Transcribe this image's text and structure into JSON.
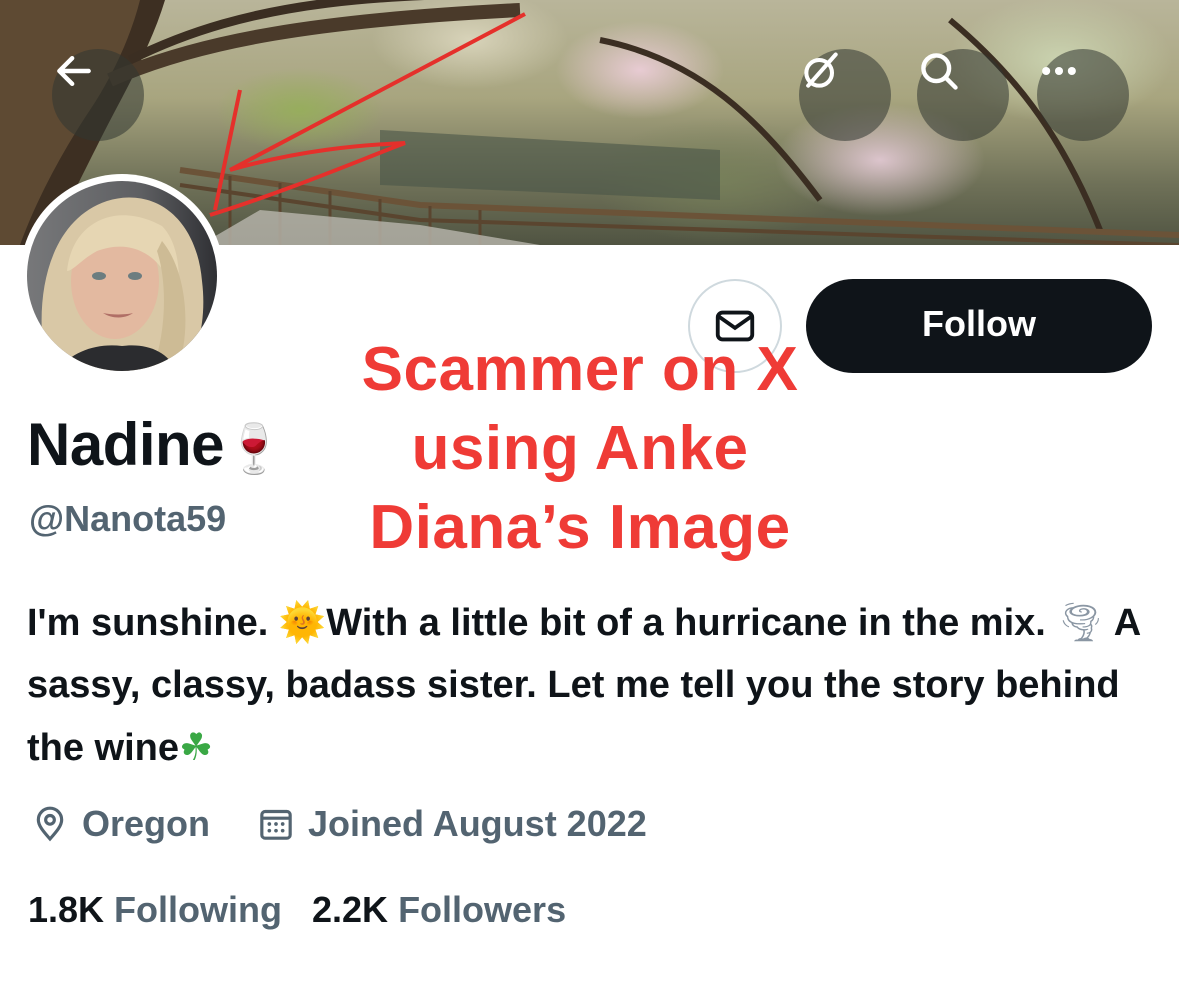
{
  "header": {
    "back_icon": "arrow-left-icon",
    "actions": [
      "grok-icon",
      "search-icon",
      "more-icon"
    ]
  },
  "profile": {
    "display_name": "Nadine",
    "name_emoji": "🍷",
    "handle": "@Nanota59",
    "bio": {
      "part1": "I'm sunshine. ",
      "emoji_sun": "🌞",
      "part2": "With a little bit of a hurricane in the mix.",
      "emoji_tornado": "🌪",
      "part3": " A sassy, classy, badass sister. Let me tell you the story behind the wine",
      "emoji_clover": "☘"
    },
    "location": "Oregon",
    "joined": "Joined August 2022",
    "following_count": "1.8K",
    "following_label": "Following",
    "followers_count": "2.2K",
    "followers_label": "Followers"
  },
  "actions": {
    "follow_label": "Follow",
    "message_icon": "envelope-icon"
  },
  "overlay": {
    "line1": "Scammer on X",
    "line2": "using Anke",
    "line3": "Diana’s Image"
  },
  "colors": {
    "text": "#0f1419",
    "secondary": "#536471",
    "follow_bg": "#0f1419",
    "annotation": "#ef3b36"
  }
}
